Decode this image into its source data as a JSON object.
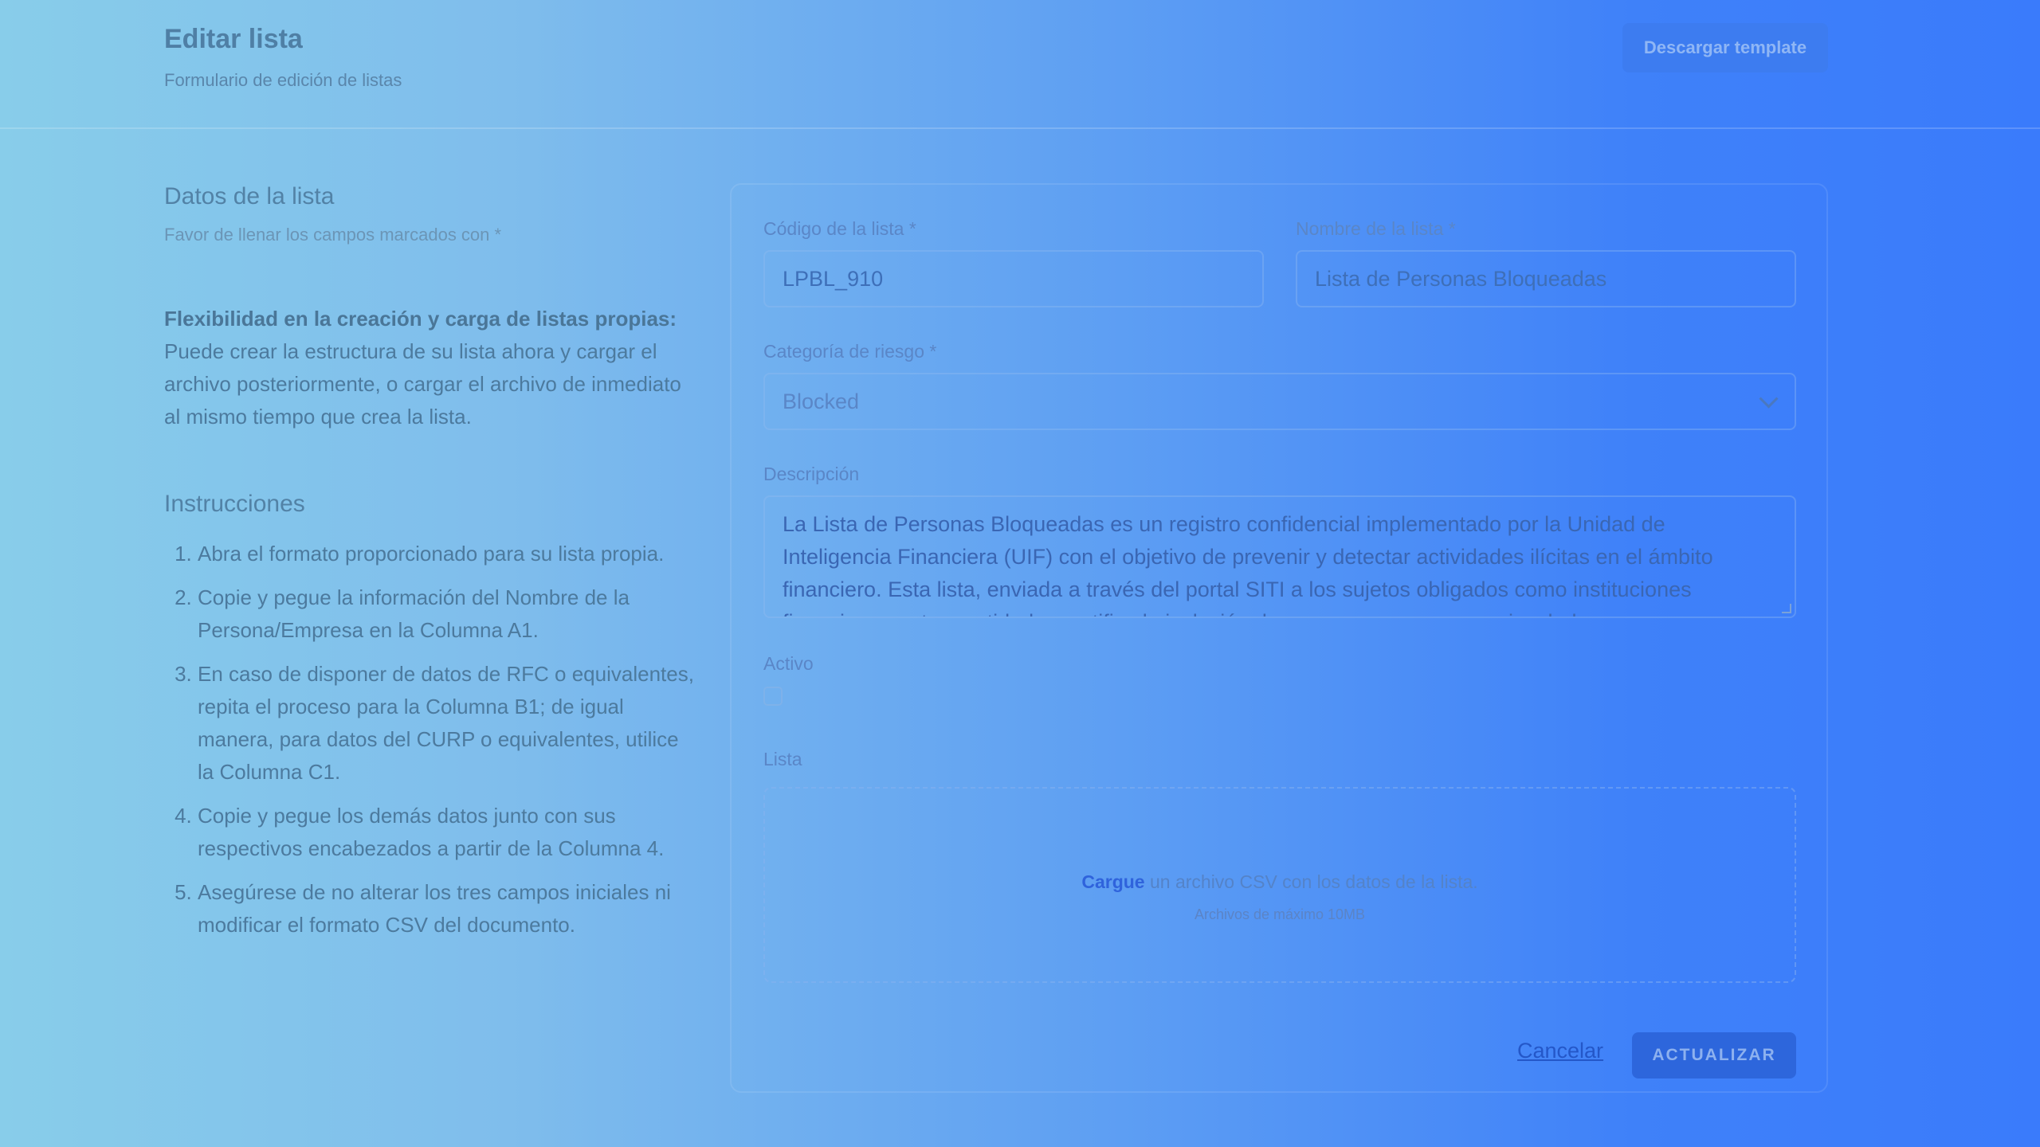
{
  "header": {
    "title": "Editar lista",
    "subtitle": "Formulario de edición de listas",
    "template_button": "Descargar template"
  },
  "left": {
    "section_title": "Datos de la lista",
    "section_note": "Favor de llenar los campos marcados con *",
    "info_bold": "Flexibilidad en la creación y carga de listas propias:",
    "info_text": "Puede crear la estructura de su lista ahora y cargar el archivo posteriormente, o cargar el archivo de inmediato al mismo tiempo que crea la lista.",
    "instructions_title": "Instrucciones",
    "instructions": [
      "Abra el formato proporcionado para su lista propia.",
      "Copie y pegue la información del Nombre de la Persona/Empresa en la Columna A1.",
      "En caso de disponer de datos de RFC o equivalentes, repita el proceso para la Columna B1; de igual manera, para datos del CURP o equivalentes, utilice la Columna C1.",
      "Copie y pegue los demás datos junto con sus respectivos encabezados a partir de la Columna 4.",
      "Asegúrese de no alterar los tres campos iniciales ni modificar el formato CSV del documento."
    ]
  },
  "form": {
    "code_label": "Código de la lista *",
    "code_value": "LPBL_910",
    "name_label": "Nombre de la lista *",
    "name_value": "Lista de Personas Bloqueadas",
    "risk_label": "Categoría de riesgo *",
    "risk_value": "Blocked",
    "description_label": "Descripción",
    "description_value": "La Lista de Personas Bloqueadas es un registro confidencial implementado por la Unidad de Inteligencia Financiera (UIF) con el objetivo de prevenir y detectar actividades ilícitas en el ámbito financiero. Esta lista, enviada a través del portal SITI a los sujetos obligados como instituciones financieras y otras entidades, notifica la inclusión de personas o empresas vinculadas",
    "active_label": "Activo",
    "list_label": "Lista",
    "upload_link": "Cargue",
    "upload_text": " un archivo CSV con los datos de la lista.",
    "upload_limit": "Archivos de máximo 10MB",
    "cancel_label": "Cancelar",
    "update_label": "ACTUALIZAR"
  }
}
